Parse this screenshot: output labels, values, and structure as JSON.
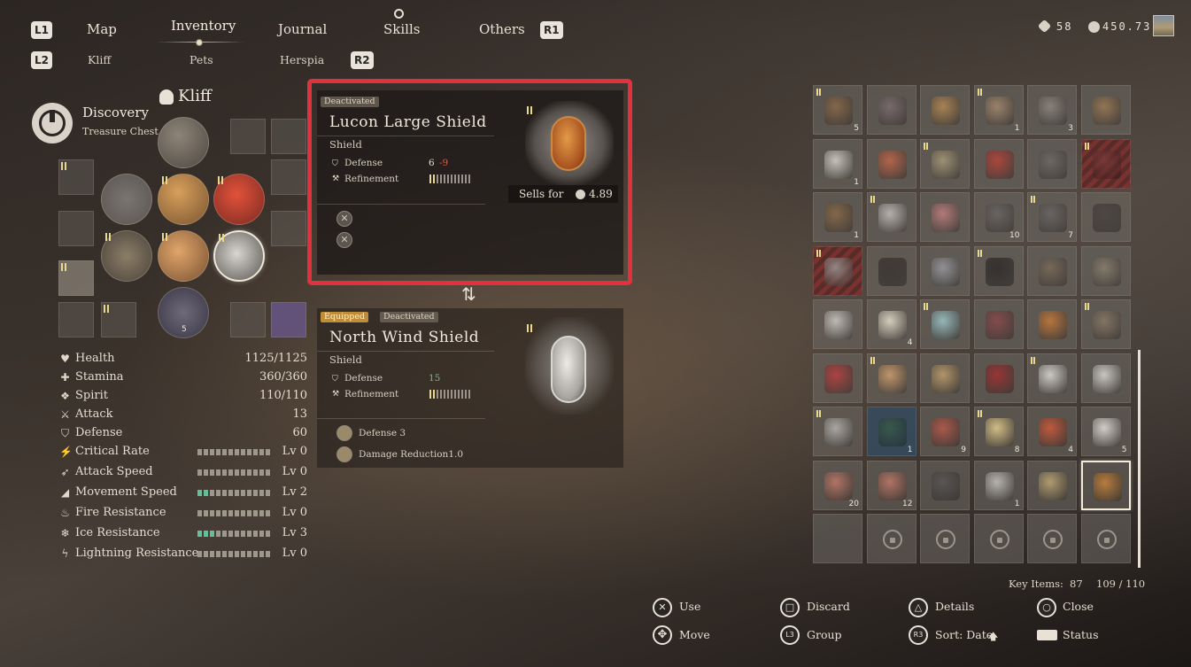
{
  "nav": {
    "buttons": {
      "l1": "L1",
      "r1": "R1",
      "l2": "L2",
      "r2": "R2"
    },
    "tabs": [
      "Map",
      "Inventory",
      "Journal",
      "Skills",
      "Others"
    ],
    "subtabs": [
      "Kliff",
      "Pets",
      "Herspia"
    ],
    "active_tab": "Inventory"
  },
  "currency": {
    "gems": "58",
    "silver": "450.73"
  },
  "character": {
    "name": "Kliff",
    "discovery_title": "Discovery",
    "discovery_sub": "Treasure  Chest",
    "slot_qty": "5"
  },
  "stats": [
    {
      "label": "Health",
      "value": "1125/1125",
      "icon": "heart-icon"
    },
    {
      "label": "Stamina",
      "value": "360/360",
      "icon": "stamina-icon"
    },
    {
      "label": "Spirit",
      "value": "110/110",
      "icon": "spirit-icon"
    },
    {
      "label": "Attack",
      "value": "13",
      "icon": "sword-icon"
    },
    {
      "label": "Defense",
      "value": "60",
      "icon": "shield-icon"
    },
    {
      "label": "Critical  Rate",
      "value": "Lv  0",
      "level": 0,
      "icon": "crit-icon"
    },
    {
      "label": "Attack  Speed",
      "value": "Lv  0",
      "level": 0,
      "icon": "attack-speed-icon"
    },
    {
      "label": "Movement  Speed",
      "value": "Lv  2",
      "level": 2,
      "icon": "boot-icon"
    },
    {
      "label": "Fire  Resistance",
      "value": "Lv  0",
      "level": 0,
      "icon": "fire-icon"
    },
    {
      "label": "Ice  Resistance",
      "value": "Lv  3",
      "level": 3,
      "icon": "snowflake-icon"
    },
    {
      "label": "Lightning  Resistance",
      "value": "Lv  0",
      "level": 0,
      "icon": "lightning-icon"
    }
  ],
  "stat_max_level": 12,
  "item_compare": {
    "tag": "Deactivated",
    "name": "Lucon  Large  Shield",
    "type": "Shield",
    "defense_label": "Defense",
    "defense_value": "6",
    "defense_diff": "-9",
    "refinement_label": "Refinement",
    "refinement_level": 2,
    "sells_label": "Sells  for",
    "sells_value": "4.89"
  },
  "swap_icon": "⇅",
  "item_equipped": {
    "tag_equipped": "Equipped",
    "tag_state": "Deactivated",
    "name": "North  Wind  Shield",
    "type": "Shield",
    "defense_label": "Defense",
    "defense_value": "15",
    "refinement_label": "Refinement",
    "refinement_level": 2,
    "perks": [
      "Defense  3",
      "Damage  Reduction1.0"
    ]
  },
  "inventory": {
    "key_items_label": "Key  Items:",
    "key_items_value": "87",
    "capacity": "109  /  110",
    "cells": [
      {
        "q": "5",
        "c": "#8a6a4a"
      },
      {
        "c": "#7d6d72"
      },
      {
        "c": "#b58a55"
      },
      {
        "q": "1",
        "c": "#a58a70"
      },
      {
        "q": "3",
        "c": "#8f8880"
      },
      {
        "c": "#9b7a55"
      },
      {
        "q": "1",
        "c": "#d8d4cc"
      },
      {
        "c": "#c0674b"
      },
      {
        "c": "#a89a7a"
      },
      {
        "c": "#b8443a"
      },
      {
        "c": "#6e6a66"
      },
      {
        "c": "#7a3a3a",
        "r": 1
      },
      {
        "q": "1",
        "c": "#8a6a4a"
      },
      {
        "c": "#c4c0bc"
      },
      {
        "c": "#c08080"
      },
      {
        "q": "10",
        "c": "#6a6664"
      },
      {
        "q": "7",
        "c": "#6a6664"
      },
      {
        "c": "#4a4440"
      },
      {
        "c": "#9a9590",
        "r": 1
      },
      {
        "c": "#3a3432"
      },
      {
        "c": "#9a9aa0"
      },
      {
        "c": "#2e2a2a"
      },
      {
        "c": "#7a6a5a"
      },
      {
        "c": "#8a8070"
      },
      {
        "c": "#cfcac4"
      },
      {
        "q": "4",
        "c": "#e8e2cf"
      },
      {
        "c": "#a0c8cc"
      },
      {
        "c": "#8a4a4a"
      },
      {
        "c": "#c67a3a"
      },
      {
        "c": "#8a7a68"
      },
      {
        "c": "#b84040"
      },
      {
        "c": "#d0a070"
      },
      {
        "c": "#c0a070"
      },
      {
        "c": "#a03030"
      },
      {
        "c": "#e0ded8"
      },
      {
        "c": "#dcdad4"
      },
      {
        "c": "#b8b4b0"
      },
      {
        "q": "1",
        "c": "#3a5a4a",
        "b": 1
      },
      {
        "q": "9",
        "c": "#b85a4a"
      },
      {
        "q": "8",
        "c": "#e6d090"
      },
      {
        "q": "4",
        "c": "#d05a3a"
      },
      {
        "q": "5",
        "c": "#e8e4dc"
      },
      {
        "q": "20",
        "c": "#c07a6a"
      },
      {
        "q": "12",
        "c": "#c07a6a"
      },
      {
        "c": "#5a5654"
      },
      {
        "q": "1",
        "c": "#c8c4c0"
      },
      {
        "c": "#c0a878"
      },
      {
        "c": "#c8843a",
        "s": 1
      },
      {
        "e": 1
      },
      {
        "l": 1
      },
      {
        "l": 1
      },
      {
        "l": 1
      },
      {
        "l": 1
      },
      {
        "l": 1
      }
    ]
  },
  "controls": [
    {
      "label": "Use",
      "glyph": "✕"
    },
    {
      "label": "Move",
      "glyph": "✥"
    },
    {
      "label": "Discard",
      "glyph": "□"
    },
    {
      "label": "Group",
      "glyph": "L3"
    },
    {
      "label": "Details",
      "glyph": "△"
    },
    {
      "label": "Sort:  Date",
      "glyph": "R3",
      "arrow": "🡅"
    },
    {
      "label": "Close",
      "glyph": "○"
    },
    {
      "label": "Status",
      "glyph": ""
    }
  ]
}
